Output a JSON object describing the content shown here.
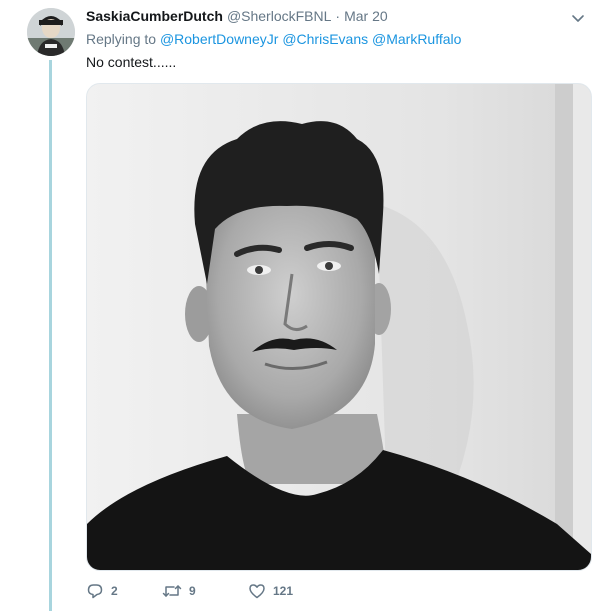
{
  "tweet": {
    "display_name": "SaskiaCumberDutch",
    "handle": "@SherlockFBNL",
    "separator": "·",
    "date": "Mar 20",
    "replying_prefix": "Replying to",
    "mentions": [
      "@RobertDowneyJr",
      "@ChrisEvans",
      "@MarkRuffalo"
    ],
    "text": "No contest......",
    "media": {
      "kind": "photo",
      "tone": "black-and-white"
    },
    "actions": {
      "reply_icon": "reply-bubble-icon",
      "reply_count": "2",
      "retweet_icon": "retweet-arrows-icon",
      "retweet_count": "9",
      "like_icon": "heart-icon",
      "like_count": "121"
    },
    "menu_icon": "chevron-down-icon"
  },
  "colors": {
    "text": "#14171a",
    "secondary_text": "#657786",
    "link": "#1b95e0",
    "thread_line": "#a8d5de",
    "border": "#e1e8ed"
  }
}
